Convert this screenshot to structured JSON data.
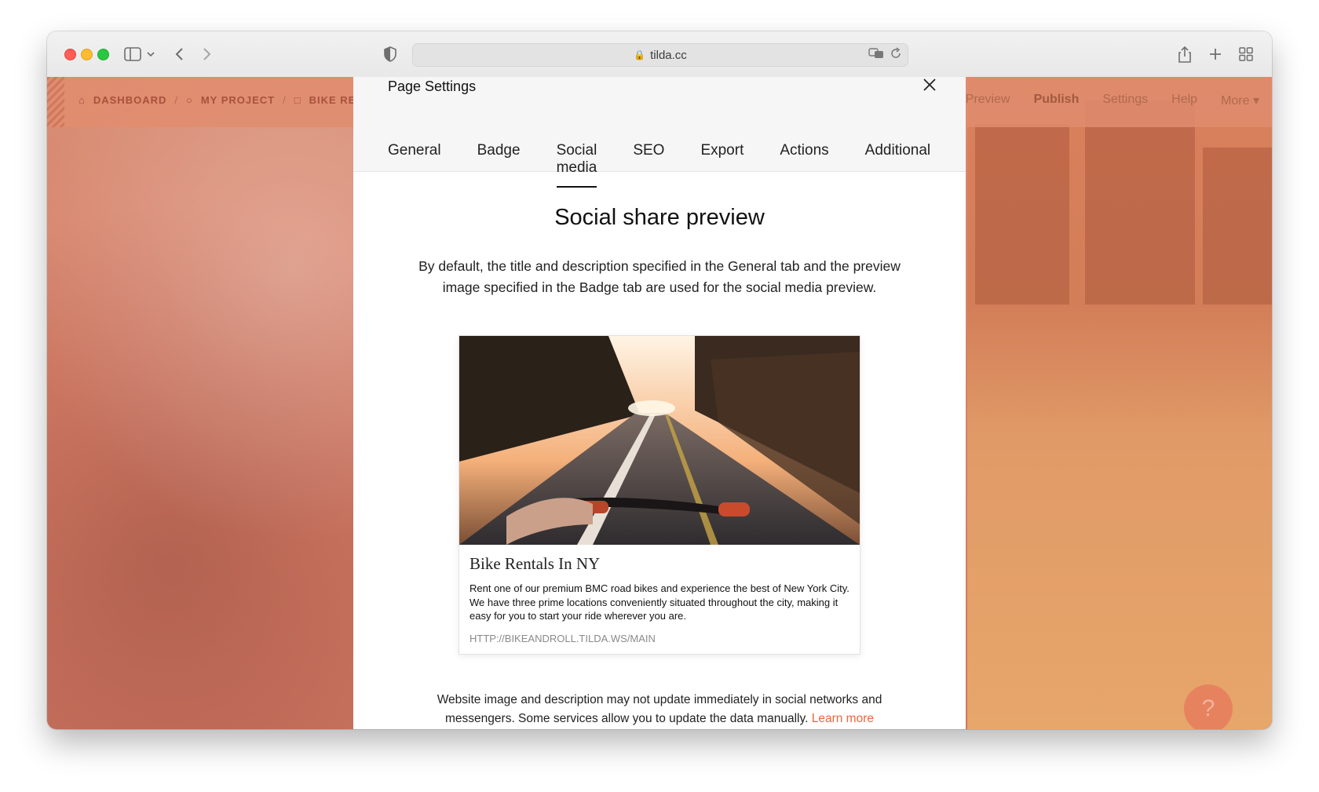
{
  "browser": {
    "url": "tilda.cc"
  },
  "app": {
    "breadcrumbs": [
      "DASHBOARD",
      "MY PROJECT",
      "BIKE RE"
    ],
    "nav": [
      "Preview",
      "Publish",
      "Settings",
      "Help",
      "More ▾"
    ],
    "help_label": "?"
  },
  "modal": {
    "title": "Page Settings",
    "tabs": [
      "General",
      "Badge",
      "Social media",
      "SEO",
      "Export",
      "Actions",
      "Additional"
    ],
    "active_tab": "Social media",
    "heading": "Social share preview",
    "description": "By default, the title and description specified in the General tab and the preview image specified in the Badge tab are used for the social media preview.",
    "card": {
      "title": "Bike Rentals In NY",
      "description": "Rent one of our premium BMC road bikes and experience the best of New York City. We have three prime locations conveniently situated throughout the city, making it easy for you to start your ride wherever you are.",
      "url": "HTTP://BIKEANDROLL.TILDA.WS/MAIN"
    },
    "note": "Website image and description may not update immediately in social networks and messengers. Some services allow you to update the data manually.",
    "note_link": "Learn more"
  },
  "colors": {
    "accent": "#f0643c",
    "overlay": "#d8816a"
  }
}
